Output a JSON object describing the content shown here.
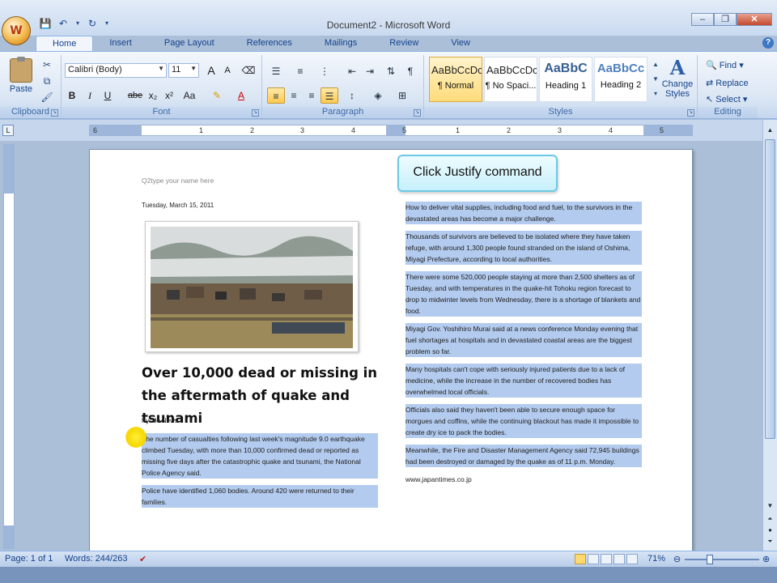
{
  "window": {
    "title": "Document2 - Microsoft Word"
  },
  "quick_access": {
    "office_button": "W"
  },
  "tabs": [
    "Home",
    "Insert",
    "Page Layout",
    "References",
    "Mailings",
    "Review",
    "View"
  ],
  "ribbon": {
    "clipboard": {
      "label": "Clipboard",
      "paste": "Paste"
    },
    "font": {
      "label": "Font",
      "font_name": "Calibri (Body)",
      "font_size": "11",
      "bold": "B",
      "italic": "I",
      "underline": "U",
      "strike": "abe",
      "subscript": "x₂",
      "superscript": "x²",
      "change_case": "Aa",
      "grow": "A",
      "shrink": "A"
    },
    "paragraph": {
      "label": "Paragraph",
      "pilcrow": "¶"
    },
    "styles": {
      "label": "Styles",
      "items": [
        {
          "preview": "AaBbCcDc",
          "name": "¶ Normal"
        },
        {
          "preview": "AaBbCcDc",
          "name": "¶ No Spaci..."
        },
        {
          "preview": "AaBbC",
          "name": "Heading 1"
        },
        {
          "preview": "AaBbCc",
          "name": "Heading 2"
        }
      ],
      "change_styles": "Change Styles"
    },
    "editing": {
      "label": "Editing",
      "find": "Find",
      "replace": "Replace",
      "select": "Select"
    }
  },
  "ruler": {
    "numbers": [
      "6",
      "1",
      "2",
      "3",
      "4",
      "5",
      "1",
      "2",
      "3",
      "4",
      "5"
    ]
  },
  "callout": "Click Justify command",
  "document": {
    "placeholder": "Q2type your name here",
    "date": "Tuesday, March 15, 2011",
    "headline": "Over 10,000 dead or missing in the aftermath of quake and tsunami",
    "byline": "Kyodo News",
    "left_paragraphs": [
      "The number of casualties following last week's magnitude 9.0 earthquake climbed Tuesday, with more than 10,000 confirmed dead or reported as missing five days after the catastrophic quake and tsunami, the National Police Agency said.",
      "Police have identified 1,060 bodies. Around 420 were returned to their families."
    ],
    "right_paragraphs": [
      "How to deliver vital supplies, including food and fuel, to the survivors in the devastated areas has become a major challenge.",
      "Thousands of survivors are believed to be isolated where they have taken refuge, with around 1,300 people found stranded on the island of Oshima, Miyagi Prefecture, according to local authorities.",
      "There were some 520,000 people staying at more than 2,500 shelters as of Tuesday, and with temperatures in the quake-hit Tohoku region forecast to drop to midwinter levels from Wednesday, there is a shortage of blankets and food.",
      "Miyagi Gov. Yoshihiro Murai said at a news conference Monday evening that fuel shortages at hospitals and in devastated coastal areas are the biggest problem so far.",
      "Many hospitals can't cope with seriously injured patients due to a lack of medicine, while the increase in the number of recovered bodies has overwhelmed local officials.",
      "Officials also said they haven't been able to secure enough space for morgues and coffins, while the continuing blackout has made it impossible to create dry ice to pack the bodies.",
      "Meanwhile, the Fire and Disaster Management Agency said 72,945 buildings had been destroyed or damaged by the quake as of 11 p.m. Monday."
    ],
    "source": "www.japantimes.co.jp"
  },
  "status": {
    "page": "Page: 1 of 1",
    "words": "Words: 244/263",
    "zoom": "71%"
  }
}
